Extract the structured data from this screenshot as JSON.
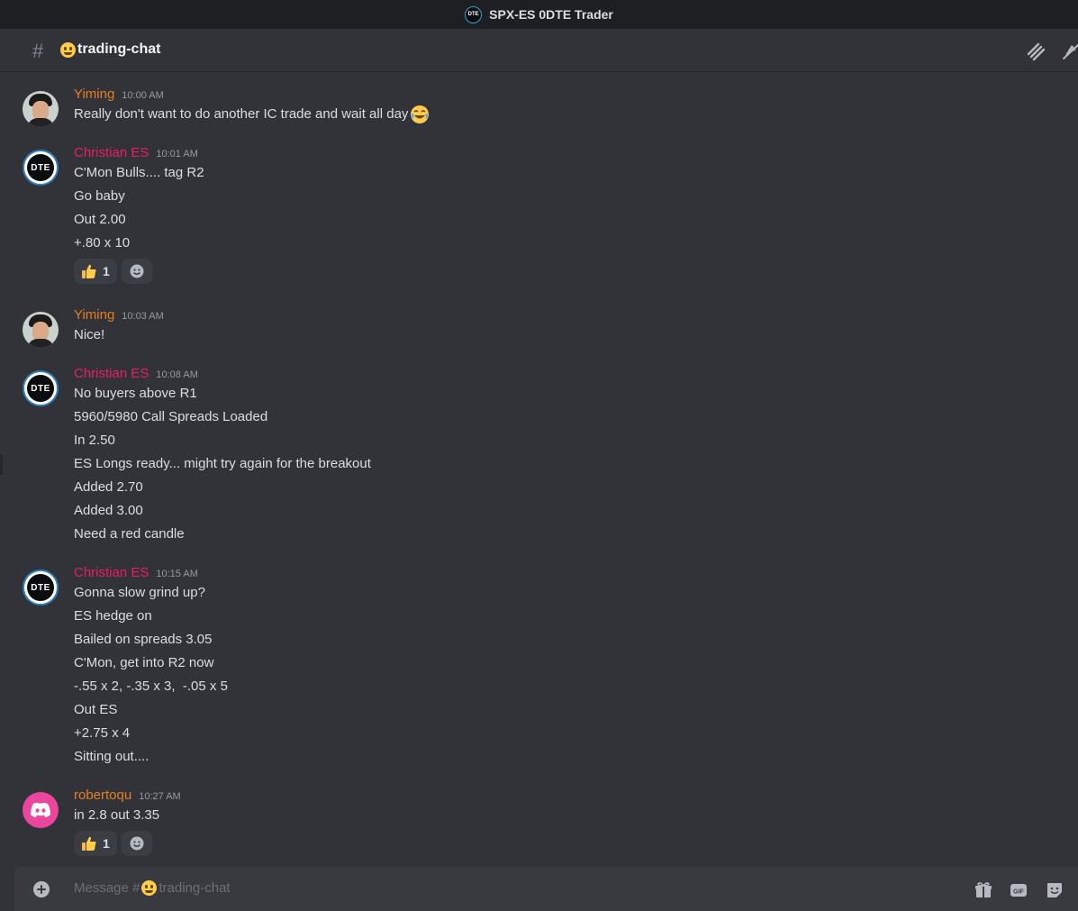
{
  "window": {
    "title": "SPX-ES 0DTE Trader",
    "server_logo_text": "DTE"
  },
  "header": {
    "channel_name": "trading-chat"
  },
  "messages": [
    {
      "author": "Yiming",
      "time": "10:00 AM",
      "avatar": "photo",
      "lines": [
        "Really don't want to do another IC trade and wait all day"
      ],
      "trailing_emoji": "joy-emoji"
    },
    {
      "author": "Christian ES",
      "time": "10:01 AM",
      "avatar": "DTE",
      "lines": [
        "C'Mon Bulls.... tag R2",
        "Go baby",
        "Out 2.00",
        "+.80 x 10"
      ],
      "reaction": {
        "emoji": "thumbs-up",
        "count": "1"
      }
    },
    {
      "author": "Yiming",
      "time": "10:03 AM",
      "avatar": "photo",
      "lines": [
        "Nice!"
      ]
    },
    {
      "author": "Christian ES",
      "time": "10:08 AM",
      "avatar": "DTE",
      "lines": [
        "No buyers above R1",
        "5960/5980 Call Spreads Loaded",
        "In 2.50",
        "ES Longs ready... might try again for the breakout",
        "Added 2.70",
        "Added 3.00",
        "Need a red candle"
      ]
    },
    {
      "author": "Christian ES",
      "time": "10:15 AM",
      "avatar": "DTE",
      "lines": [
        "Gonna slow grind up?",
        "ES hedge on",
        "Bailed on spreads 3.05",
        "C'Mon, get into R2 now",
        "-.55 x 2, -.35 x 3,  -.05 x 5",
        "Out ES",
        "+2.75 x 4",
        "Sitting out...."
      ]
    },
    {
      "author": "robertoqu",
      "time": "10:27 AM",
      "avatar": "discord",
      "lines": [
        "in 2.8 out 3.35"
      ],
      "reaction": {
        "emoji": "thumbs-up",
        "count": "1"
      }
    }
  ],
  "composer": {
    "placeholder_prefix": "Message #",
    "placeholder_channel": "trading-chat"
  },
  "colors": {
    "background": "#313338",
    "titlebar": "#1e1f22",
    "orange_name": "#e67e22",
    "pink_name": "#e91e63",
    "discord_avatar": "#eb459e"
  }
}
